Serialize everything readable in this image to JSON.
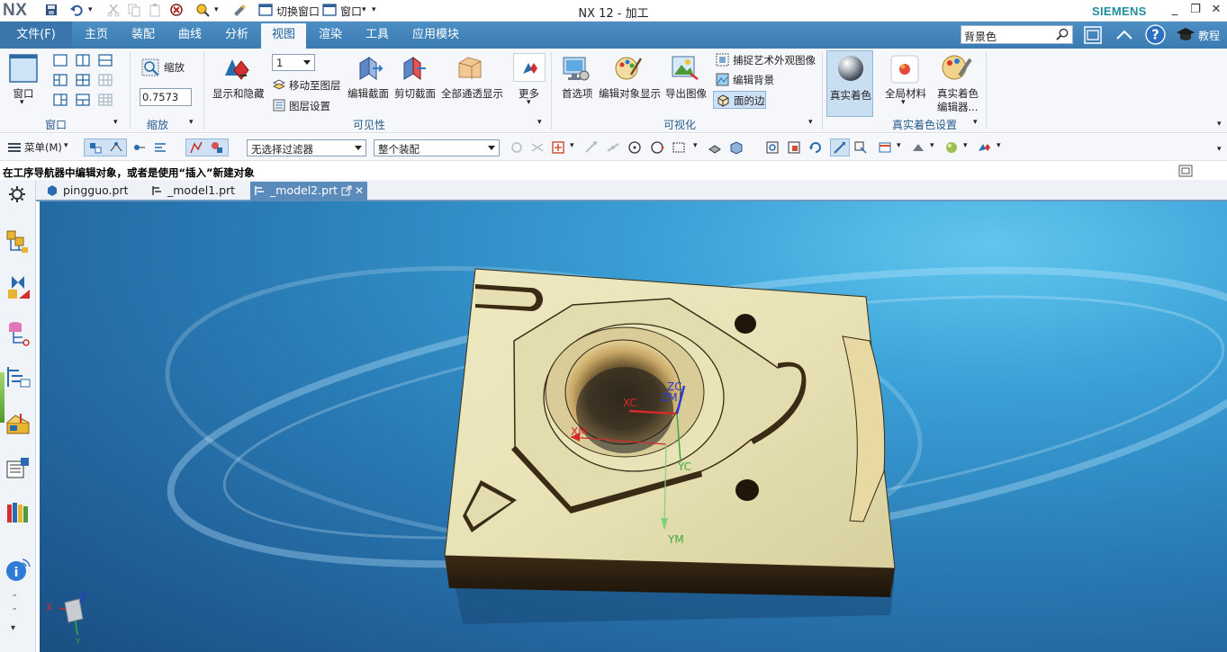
{
  "app": {
    "logo": "NX",
    "title": "NX 12 - 加工",
    "brand": "SIEMENS",
    "tutorial_label": "教程"
  },
  "quick_access": {
    "switch_window_label": "切换窗口",
    "window_label": "窗口"
  },
  "menubar": {
    "file_label": "文件(F)",
    "tabs": [
      "主页",
      "装配",
      "曲线",
      "分析",
      "视图",
      "渲染",
      "工具",
      "应用模块"
    ],
    "active_tab": "视图",
    "search_value": "背景色"
  },
  "ribbon": {
    "window_group": {
      "window_label": "窗口",
      "group_label": "窗口"
    },
    "zoom_group": {
      "zoom_label": "缩放",
      "zoom_value": "0.7573",
      "group_label": "缩放"
    },
    "visibility_group": {
      "show_hide_label": "显示和隐藏",
      "layer_value": "1",
      "move_to_layer_label": "移动至图层",
      "layer_settings_label": "图层设置",
      "edit_section_label": "编辑截面",
      "clip_section_label": "剪切截面",
      "show_all_label": "全部通透显示",
      "more_label": "更多",
      "group_label": "可见性"
    },
    "visualization_group": {
      "preferences_label": "首选项",
      "edit_object_display_label": "编辑对象显示",
      "export_image_label": "导出图像",
      "capture_art_label": "捕捉艺术外观图像",
      "edit_background_label": "编辑背景",
      "face_edges_label": "面的边",
      "group_label": "可视化"
    },
    "true_shading_group": {
      "true_shading_label": "真实着色",
      "global_material_label": "全局材料",
      "true_shading_editor_line1": "真实着色",
      "true_shading_editor_line2": "编辑器...",
      "group_label": "真实着色设置"
    }
  },
  "toolbar2": {
    "menu_label": "菜单(M)",
    "filter_value": "无选择过滤器",
    "assembly_scope_value": "整个装配"
  },
  "status": {
    "message": "在工序导航器中编辑对象，或者是使用“插入”新建对象"
  },
  "doc_tabs": [
    {
      "label": "pingguo.prt",
      "active": false
    },
    {
      "label": "_model1.prt",
      "active": false
    },
    {
      "label": "_model2.prt",
      "active": true
    }
  ],
  "viewport": {
    "csys_labels": {
      "xc": "XC",
      "yc": "YC",
      "zc": "ZC",
      "xm": "XM",
      "ym": "YM",
      "zm": "ZM"
    },
    "triad_labels": {
      "x": "X",
      "y": "Y",
      "z": "Z"
    }
  },
  "colors": {
    "menubar": "#3f82b9",
    "ribbon_label": "#2a5c8f",
    "part_face": "#e9e4b8",
    "viewport_top": "#48b8e8",
    "viewport_bottom": "#1d5489"
  }
}
